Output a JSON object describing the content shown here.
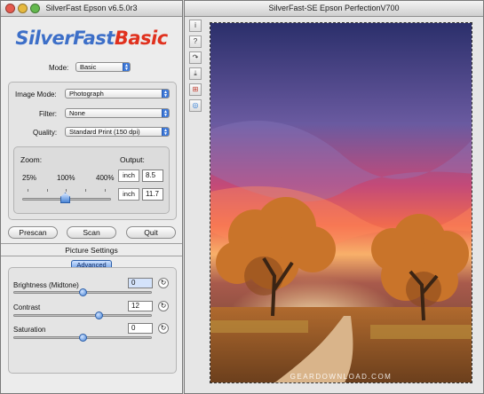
{
  "control_window": {
    "title": "SilverFast Epson v6.5.0r3",
    "logo": {
      "silverfast": "SilverFast",
      "basic": "Basic"
    },
    "mode": {
      "label": "Mode:",
      "value": "Basic"
    },
    "image_mode": {
      "label": "Image Mode:",
      "value": "Photograph"
    },
    "filter": {
      "label": "Filter:",
      "value": "None"
    },
    "quality": {
      "label": "Quality:",
      "value": "Standard Print (150 dpi)"
    },
    "zoom": {
      "label": "Zoom:",
      "min": "25%",
      "mid": "100%",
      "max": "400%"
    },
    "output": {
      "label": "Output:",
      "unit1": "inch",
      "value1": "8.5",
      "unit2": "inch",
      "value2": "11.7"
    },
    "buttons": {
      "prescan": "Prescan",
      "scan": "Scan",
      "quit": "Quit"
    },
    "picture_settings": {
      "title": "Picture Settings",
      "advanced": "Advanced",
      "brightness": {
        "label": "Brightness (Midtone)",
        "value": "0",
        "level": 0.5
      },
      "contrast": {
        "label": "Contrast",
        "value": "12",
        "level": 0.56
      },
      "saturation": {
        "label": "Saturation",
        "value": "0",
        "level": 0.5
      }
    }
  },
  "preview_window": {
    "title": "SilverFast-SE Epson PerfectionV700",
    "tools": [
      "info-icon",
      "help-icon",
      "undo-icon",
      "autofit-icon",
      "multi-frame-icon",
      "magnifier-icon"
    ],
    "tool_glyphs": [
      "i",
      "?",
      "↷",
      "⤓",
      "⊞",
      "◎"
    ],
    "watermark": "GEARDOWNLOAD.COM"
  },
  "colors": {
    "accent": "#3d78d8",
    "logo_blue": "#3d6fc8",
    "logo_red": "#e0311e"
  }
}
